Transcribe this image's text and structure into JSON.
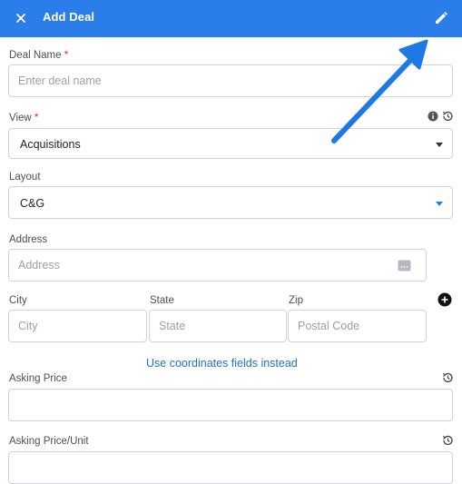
{
  "header": {
    "title": "Add Deal",
    "close_icon": "close-icon",
    "edit_icon": "pencil-icon",
    "bg_color": "#2b7de9"
  },
  "deal_name": {
    "label": "Deal Name",
    "required_mark": "*",
    "placeholder": "Enter deal name",
    "value": ""
  },
  "view": {
    "label": "View",
    "required_mark": "*",
    "value": "Acquisitions"
  },
  "layout": {
    "label": "Layout",
    "value": "C&G"
  },
  "address": {
    "label": "Address",
    "placeholder": "Address",
    "value": ""
  },
  "city": {
    "label": "City",
    "placeholder": "City"
  },
  "state": {
    "label": "State",
    "placeholder": "State"
  },
  "zip": {
    "label": "Zip",
    "placeholder": "Postal Code"
  },
  "coordinates_link": "Use coordinates fields instead",
  "asking_price": {
    "label": "Asking Price",
    "value": ""
  },
  "asking_price_unit": {
    "label": "Asking Price/Unit",
    "value": ""
  },
  "annotation": {
    "arrow_color": "#1e78e6"
  }
}
